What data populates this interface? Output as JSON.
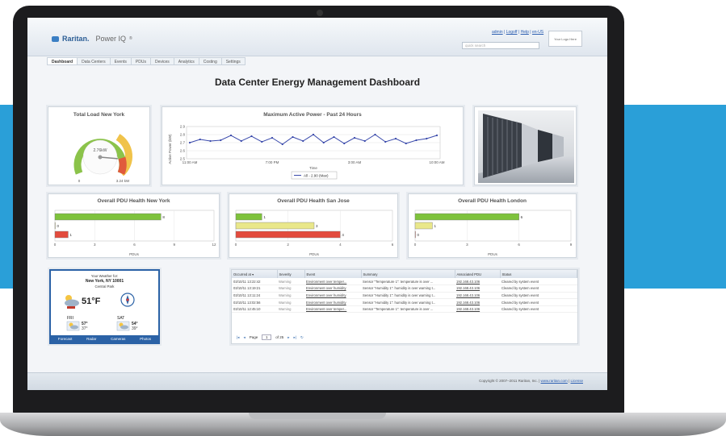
{
  "colors": {
    "band": "#2a9fd8",
    "accent": "#2c5e95",
    "green": "#7ec23c",
    "yellow": "#e9e78a",
    "red": "#e34b3d",
    "weather_border": "#2b62a6"
  },
  "brand": {
    "company": "Raritan.",
    "product": "Power IQ",
    "product_mark": "®",
    "logo_icon": "raritan-logo-icon"
  },
  "header": {
    "user_links": [
      "admin",
      "Logoff",
      "Help",
      "en-US"
    ],
    "search_placeholder": "quick search",
    "logo_placeholder": "Your Logo Here"
  },
  "tabs": [
    {
      "label": "Dashboard",
      "active": true
    },
    {
      "label": "Data Centers",
      "active": false
    },
    {
      "label": "Events",
      "active": false
    },
    {
      "label": "PDUs",
      "active": false
    },
    {
      "label": "Devices",
      "active": false
    },
    {
      "label": "Analytics",
      "active": false
    },
    {
      "label": "Costing",
      "active": false
    },
    {
      "label": "Settings",
      "active": false
    }
  ],
  "page_title": "Data Center Energy Management Dashboard",
  "gauge": {
    "title": "Total Load New York",
    "value_label": "2.76kW",
    "min_label": "0",
    "max_label": "3.24 kW",
    "value": 2.76,
    "max": 3.24
  },
  "chart_data": [
    {
      "type": "line",
      "title": "Maximum Active Power - Past 24 Hours",
      "ylabel": "Active Power (kW)",
      "xlabel": "Time",
      "x_ticks": [
        "11:00 AM",
        "7:00 PM",
        "3:00 AM",
        "10:00 AM"
      ],
      "y_ticks": [
        "2.5",
        "2.6",
        "2.7",
        "2.8",
        "2.9"
      ],
      "ylim": [
        2.5,
        2.9
      ],
      "legend": "All - 2.90 (Max)",
      "grid": true,
      "series": [
        {
          "values": [
            2.7,
            2.74,
            2.72,
            2.73,
            2.79,
            2.72,
            2.78,
            2.71,
            2.76,
            2.68,
            2.77,
            2.72,
            2.8,
            2.7,
            2.77,
            2.69,
            2.76,
            2.72,
            2.8,
            2.71,
            2.75,
            2.69,
            2.73,
            2.75,
            2.79
          ]
        }
      ]
    },
    {
      "type": "bar",
      "title": "Overall PDU Health New York",
      "xlabel": "PDUs",
      "x_ticks": [
        "0",
        "3",
        "6",
        "9",
        "12"
      ],
      "xlim": [
        0,
        12
      ],
      "values": [
        8,
        0,
        1
      ],
      "value_labels": [
        "8",
        "0",
        "1"
      ],
      "bar_colors": [
        "#7ec23c",
        "#e9e78a",
        "#e34b3d"
      ]
    },
    {
      "type": "bar",
      "title": "Overall PDU Health San Jose",
      "xlabel": "PDUs",
      "x_ticks": [
        "0",
        "2",
        "4",
        "6"
      ],
      "xlim": [
        0,
        6
      ],
      "values": [
        1,
        3,
        4
      ],
      "value_labels": [
        "1",
        "3",
        "4"
      ],
      "bar_colors": [
        "#7ec23c",
        "#e9e78a",
        "#e34b3d"
      ]
    },
    {
      "type": "bar",
      "title": "Overall PDU Health London",
      "xlabel": "PDUs",
      "x_ticks": [
        "0",
        "3",
        "6",
        "9"
      ],
      "xlim": [
        0,
        9
      ],
      "values": [
        6,
        1,
        0
      ],
      "value_labels": [
        "6",
        "1",
        "0"
      ],
      "bar_colors": [
        "#7ec23c",
        "#e9e78a",
        "#e34b3d"
      ]
    }
  ],
  "weather": {
    "line1": "Your Weather for:",
    "location": "New York, NY 10001",
    "area": "Central Park",
    "temp": "51°F",
    "days": [
      {
        "day": "FRI",
        "high": "57°",
        "low": "37°"
      },
      {
        "day": "SAT",
        "high": "54°",
        "low": "39°"
      }
    ],
    "nav": [
      "Forecast",
      "Radar",
      "Cameras",
      "Photos"
    ]
  },
  "events": {
    "columns": [
      "Occurred at",
      "Severity",
      "Event",
      "Summary",
      "Associated PDU",
      "Status"
    ],
    "rows": [
      [
        "03/10/11 13:22:42",
        "Warning",
        "Environment over temper...",
        "Sensor \"Temperature 1\": temperature is over ...",
        "192.168.43.106",
        "Cleared by system event"
      ],
      [
        "03/10/11 13:19:21",
        "Warning",
        "Environment over humidity",
        "Sensor \"Humidity 1\": humidity is over warning t...",
        "192.168.43.106",
        "Cleared by system event"
      ],
      [
        "03/10/11 13:11:24",
        "Warning",
        "Environment over humidity",
        "Sensor \"Humidity 1\": humidity is over warning t...",
        "192.168.43.106",
        "Cleared by system event"
      ],
      [
        "03/10/11 13:02:56",
        "Warning",
        "Environment over humidity",
        "Sensor \"Humidity 1\": humidity is over warning t...",
        "192.168.43.106",
        "Cleared by system event"
      ],
      [
        "03/10/11 12:45:10",
        "Warning",
        "Environment over temper...",
        "Sensor \"Temperature 1\": temperature is over ...",
        "192.168.43.106",
        "Cleared by system event"
      ]
    ],
    "pager": {
      "page_label": "Page",
      "page_value": "1",
      "of_label": "of 25"
    }
  },
  "footer": {
    "copyright": "Copyright © 2007–2011 Raritan, Inc.",
    "site": "www.raritan.com",
    "license": "License"
  }
}
